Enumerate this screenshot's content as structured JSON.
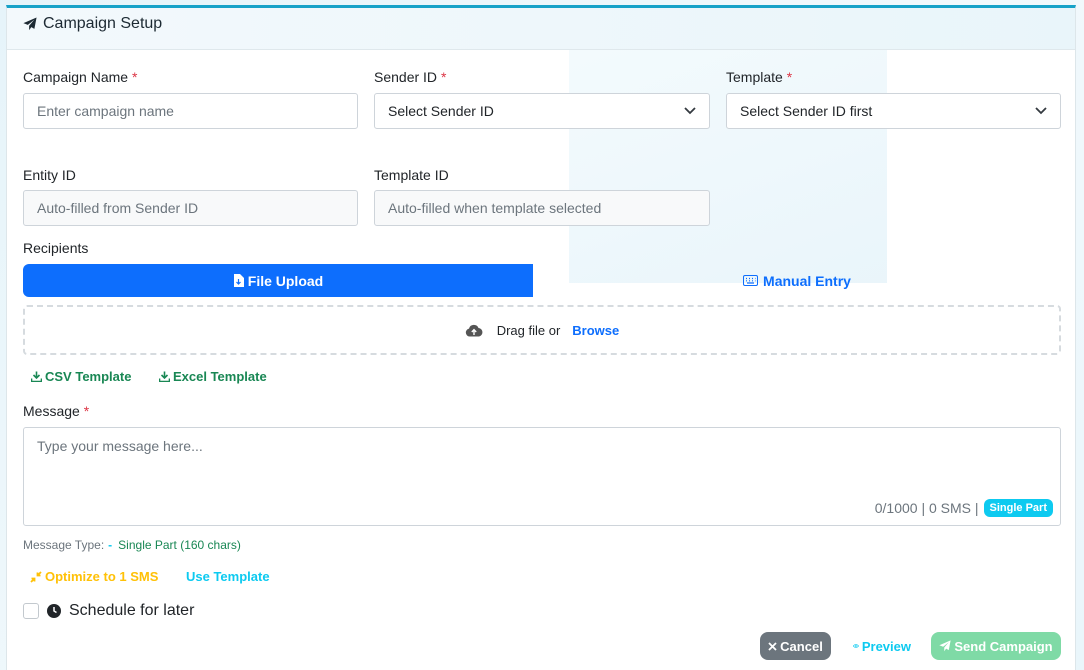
{
  "header": {
    "title": "Campaign Setup",
    "icon": "paper-plane-icon"
  },
  "fields": {
    "campaign_name": {
      "label": "Campaign Name",
      "required": "*",
      "placeholder": "Enter campaign name"
    },
    "sender_id": {
      "label": "Sender ID",
      "required": "*",
      "value": "Select Sender ID"
    },
    "template": {
      "label": "Template",
      "required": "*",
      "value": "Select Sender ID first"
    },
    "entity_id": {
      "label": "Entity ID",
      "placeholder": "Auto-filled from Sender ID"
    },
    "template_id": {
      "label": "Template ID",
      "placeholder": "Auto-filled when template selected"
    }
  },
  "recipients": {
    "label": "Recipients",
    "tabs": [
      {
        "label": "File Upload",
        "icon": "file-icon",
        "active": true
      },
      {
        "label": "Manual Entry",
        "icon": "keyboard-icon",
        "active": false
      }
    ],
    "dropzone": {
      "icon": "cloud-upload-icon",
      "text": "Drag file or",
      "browse": "Browse"
    },
    "downloads": [
      {
        "label": "CSV Template",
        "icon": "download-icon"
      },
      {
        "label": "Excel Template",
        "icon": "download-icon"
      }
    ]
  },
  "message": {
    "label": "Message",
    "required": "*",
    "placeholder": "Type your message here...",
    "counter": "0/1000 | 0 SMS |",
    "badge": "Single Part",
    "type_label": "Message Type:",
    "type_dash": "-",
    "type_value": "Single Part (160 chars)",
    "optimize": "Optimize to 1 SMS",
    "use_template": "Use Template"
  },
  "schedule": {
    "label": "Schedule for later",
    "checked": false,
    "icon": "clock-icon"
  },
  "actions": {
    "cancel": "Cancel",
    "preview": "Preview",
    "send": "Send Campaign"
  },
  "colors": {
    "primary": "#0d6efd",
    "success": "#198754",
    "info": "#0dcaf0",
    "warning": "#ffc107",
    "danger": "#dc3545",
    "secondary": "#6c757d",
    "send_disabled": "#7fdaa6"
  }
}
